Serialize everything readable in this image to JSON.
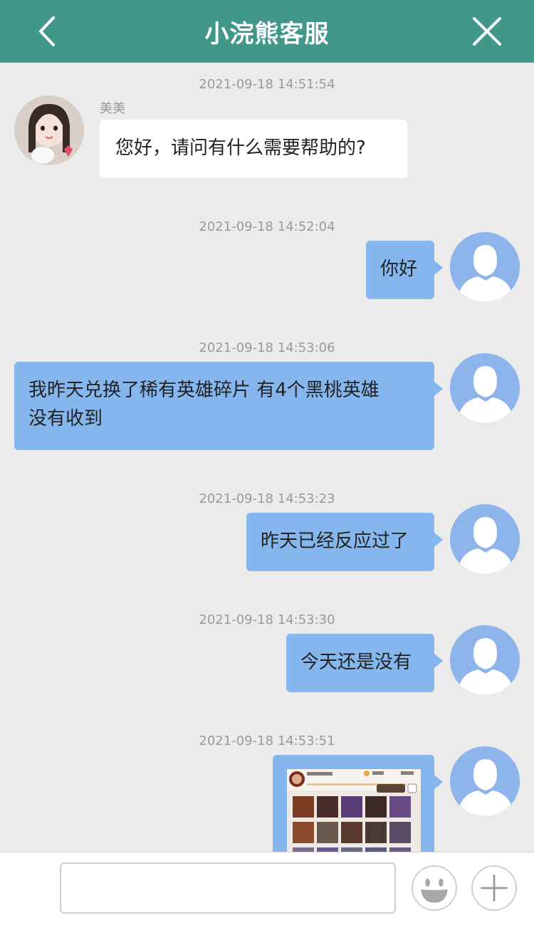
{
  "header": {
    "title": "小浣熊客服",
    "back_icon": "chevron-left-icon",
    "close_icon": "close-icon"
  },
  "messages": [
    {
      "time": "2021-09-18 14:51:54",
      "side": "left",
      "sender": "美美",
      "text": "您好，请问有什么需要帮助的?"
    },
    {
      "time": "2021-09-18 14:52:04",
      "side": "right",
      "text": "你好"
    },
    {
      "time": "2021-09-18 14:53:06",
      "side": "right",
      "text_lines": [
        "我昨天兑换了稀有英雄碎片 有4个黑桃英雄",
        "没有收到"
      ]
    },
    {
      "time": "2021-09-18 14:53:23",
      "side": "right",
      "text": "昨天已经反应过了"
    },
    {
      "time": "2021-09-18 14:53:30",
      "side": "right",
      "text": "今天还是没有"
    },
    {
      "time": "2021-09-18 14:53:51",
      "side": "right",
      "image": "game-screenshot"
    }
  ],
  "footer": {
    "input_placeholder": "",
    "emoji_icon": "emoji-icon",
    "plus_icon": "plus-icon"
  },
  "colors": {
    "header": "#41988a",
    "background": "#ebebeb",
    "user_bubble": "#85b6ee",
    "agent_bubble": "#ffffff"
  }
}
